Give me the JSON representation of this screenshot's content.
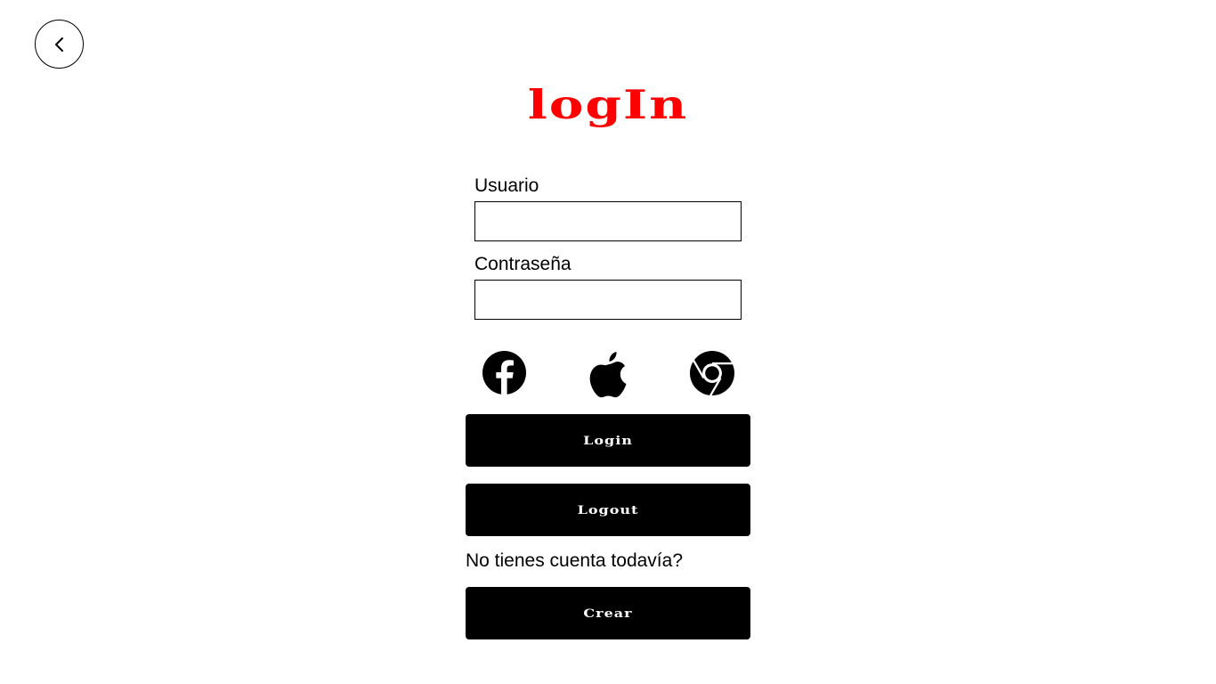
{
  "logo": {
    "text": "logIn"
  },
  "form": {
    "username_label": "Usuario",
    "username_value": "",
    "password_label": "Contraseña",
    "password_value": ""
  },
  "social": {
    "icons": [
      "facebook-icon",
      "apple-icon",
      "chrome-icon"
    ]
  },
  "buttons": {
    "login_label": "Login",
    "logout_label": "Logout",
    "create_label": "Crear"
  },
  "signup": {
    "prompt": "No tienes cuenta todavía?"
  },
  "colors": {
    "accent": "#ff0000",
    "button_bg": "#000000",
    "button_text": "#ffffff"
  }
}
